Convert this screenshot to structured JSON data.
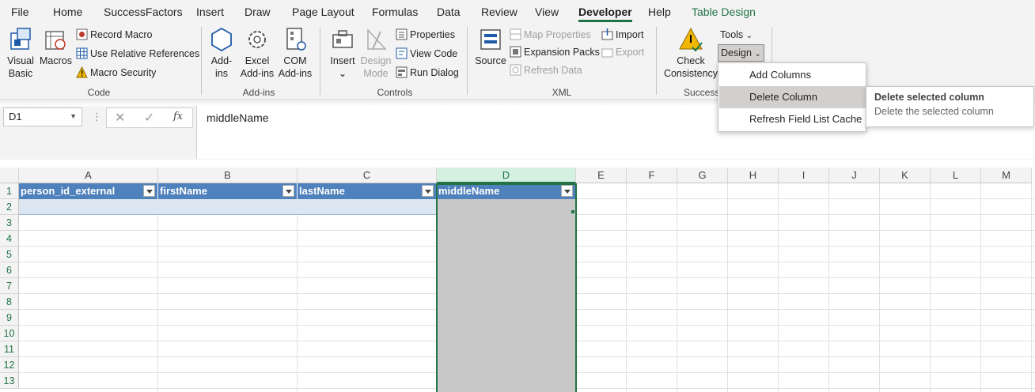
{
  "tabs": [
    "File",
    "Home",
    "SuccessFactors",
    "Insert",
    "Draw",
    "Page Layout",
    "Formulas",
    "Data",
    "Review",
    "View",
    "Developer",
    "Help",
    "Table Design"
  ],
  "ribbon": {
    "code": {
      "visual_basic": "Visual Basic",
      "visual_basic_l1": "Visual",
      "visual_basic_l2": "Basic",
      "macros": "Macros",
      "record_macro": "Record Macro",
      "use_relative": "Use Relative References",
      "macro_security": "Macro Security",
      "label": "Code"
    },
    "addins": {
      "addins_l1": "Add-",
      "addins_l2": "ins",
      "excel_l1": "Excel",
      "excel_l2": "Add-ins",
      "com_l1": "COM",
      "com_l2": "Add-ins",
      "label": "Add-ins"
    },
    "controls": {
      "insert": "Insert",
      "design_l1": "Design",
      "design_l2": "Mode",
      "properties": "Properties",
      "view_code": "View Code",
      "run_dialog": "Run Dialog",
      "label": "Controls"
    },
    "xml": {
      "source": "Source",
      "map_properties": "Map Properties",
      "expansion_packs": "Expansion Packs",
      "refresh_data": "Refresh Data",
      "import": "Import",
      "export": "Export",
      "label": "XML"
    },
    "sf": {
      "check_l1": "Check",
      "check_l2": "Consistency",
      "tools": "Tools",
      "design": "Design",
      "label": "SuccessF"
    }
  },
  "formula_bar": {
    "name_box": "D1",
    "fx": "fx",
    "content": "middleName"
  },
  "columns": [
    "A",
    "B",
    "C",
    "D",
    "E",
    "F",
    "G",
    "H",
    "I",
    "J",
    "K",
    "L",
    "M"
  ],
  "rows": [
    "1",
    "2",
    "3",
    "4",
    "5",
    "6",
    "7",
    "8",
    "9",
    "10",
    "11",
    "12",
    "13"
  ],
  "table_headers": [
    "person_id_external",
    "firstName",
    "lastName",
    "middleName"
  ],
  "design_menu": {
    "items": [
      "Add Columns",
      "Delete Column",
      "Refresh Field List Cache"
    ],
    "tooltip_title": "Delete selected column",
    "tooltip_desc": "Delete the selected column"
  },
  "colors": {
    "accent": "#217346",
    "table_header": "#4f81bd",
    "table_row": "#dce6f1",
    "selection": "#c8c8c8"
  }
}
